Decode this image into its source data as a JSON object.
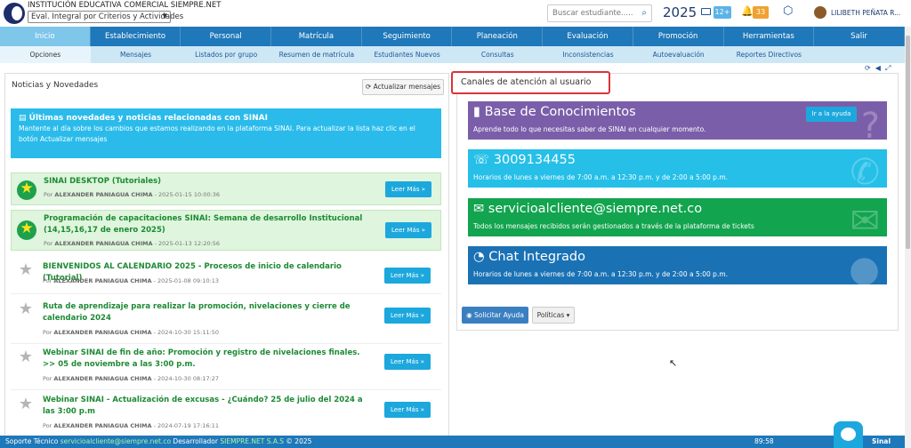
{
  "header": {
    "institution": "INSTITUCIÓN EDUCATIVA COMERCIAL SIEMPRE.NET",
    "eval_select": "Eval. Integral por Criterios y Actividades",
    "search_placeholder": "Buscar estudiante.....",
    "year": "2025",
    "messages_badge": "12+",
    "notifications_badge": "33",
    "user_name": "LILIBETH PEÑATA R..."
  },
  "nav_main": [
    "Inicio",
    "Establecimiento",
    "Personal",
    "Matrícula",
    "Seguimiento",
    "Planeación",
    "Evaluación",
    "Promoción",
    "Herramientas",
    "Salir"
  ],
  "nav_sub": [
    "Opciones",
    "Mensajes",
    "Listados por grupo",
    "Resumen de matrícula",
    "Estudiantes Nuevos",
    "Consultas",
    "Inconsistencias",
    "Autoevaluación",
    "Reportes Directivos"
  ],
  "news": {
    "title": "Noticias y Novedades",
    "update_button": "Actualizar mensajes",
    "info_heading": "Últimas novedades y noticias relacionadas con SINAI",
    "info_text": "Mantente al día sobre los cambios que estamos realizando en la plataforma SINAI. Para actualizar la lista haz clic en el botón Actualizar mensajes",
    "read_more": "Leer Más »",
    "by_label": "Por",
    "items": [
      {
        "title": "SINAI DESKTOP (Tutoriales)",
        "author": "ALEXANDER PANIAGUA CHIMA",
        "date": "- 2025-01-15 10:00:36"
      },
      {
        "title": "Programación de capacitaciones SINAI: Semana de desarrollo Institucional (14,15,16,17 de enero 2025)",
        "author": "ALEXANDER PANIAGUA CHIMA",
        "date": "- 2025-01-13 12:20:56"
      },
      {
        "title": "BIENVENIDOS AL CALENDARIO 2025 - Procesos de inicio de calendario (Tutorial)",
        "author": "ALEXANDER PANIAGUA CHIMA",
        "date": "- 2025-01-08 09:10:13"
      },
      {
        "title": "Ruta de aprendizaje para realizar la promoción, nivelaciones y cierre de calendario 2024",
        "author": "ALEXANDER PANIAGUA CHIMA",
        "date": "- 2024-10-30 15:11:50"
      },
      {
        "title": "Webinar SINAI de fin de año: Promoción y registro de nivelaciones finales. >> 05 de noviembre a las 3:00 p.m.",
        "author": "ALEXANDER PANIAGUA CHIMA",
        "date": "- 2024-10-30 08:17:27"
      },
      {
        "title": "Webinar SINAI - Actualización de excusas - ¿Cuándo? 25 de julio del 2024 a las 3:00 p.m",
        "author": "ALEXANDER PANIAGUA CHIMA",
        "date": "- 2024-07-19 17:16:11"
      }
    ]
  },
  "channels": {
    "title": "Canales de atención al usuario",
    "kb_title": "Base de Conocimientos",
    "kb_sub": "Aprende todo lo que necesitas saber de SINAI en cualquier momento.",
    "kb_button": "Ir a la ayuda",
    "phone": "3009134455",
    "phone_hours": "Horarios de lunes a viernes de 7:00 a.m. a 12:30 p.m. y de 2:00 a 5:00 p.m.",
    "email": "servicioalcliente@siempre.net.co",
    "email_sub": "Todos los mensajes recibidos serán gestionados a través de la plataforma de tickets",
    "chat": "Chat Integrado",
    "chat_hours": "Horarios de lunes a viernes de 7:00 a.m. a 12:30 p.m. y de 2:00 a 5:00 p.m.",
    "help_button": "Solicitar Ayuda",
    "policies_button": "Políticas"
  },
  "footer": {
    "support_label": "Soporte Técnico",
    "support_email": "servicioalcliente@siempre.net.co",
    "dev_label": "Desarrollador",
    "dev_name": "SIEMPRE.NET S.A.S",
    "copyright": "© 2025",
    "time": "89:58",
    "brand": "SinaI"
  }
}
